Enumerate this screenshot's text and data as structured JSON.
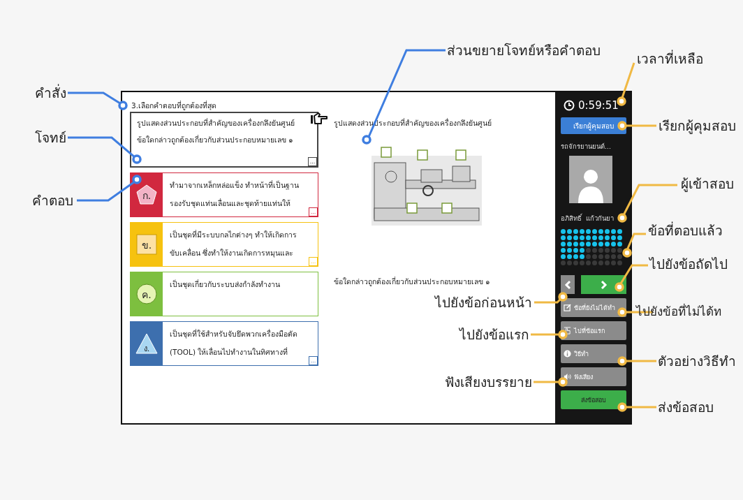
{
  "instruction": "3.เลือกคำตอบที่ถูกต้องที่สุด",
  "question": {
    "text": "รูปแสดงส่วนประกอบที่สำคัญของเครื่องกลึงยันศูนย์\nข้อใดกล่าวถูกต้องเกี่ยวกับส่วนประกอบหมายเลข ๑",
    "more": "..."
  },
  "choices": [
    {
      "label": "ก.",
      "kind": "pentagon",
      "color": "#d1283f",
      "text": "ทำมาจากเหล็กหล่อแข็ง ทำหน้าที่เป็นฐาน\nรองรับชุดแท่นเลื่อนและชุดท้ายแท่นให้",
      "more": "..."
    },
    {
      "label": "ข.",
      "kind": "square",
      "color": "#f6c20f",
      "text": "เป็นชุดที่มีระบบกลไกต่างๆ ทำให้เกิดการ\nขับเคลื่อน ซึ่งทำให้งานเกิดการหมุนและ",
      "more": "..."
    },
    {
      "label": "ค.",
      "kind": "circle",
      "color": "#7dbf3f",
      "text": "เป็นชุดเกี่ยวกับระบบส่งกำลังทำงาน"
    },
    {
      "label": "ง.",
      "kind": "triangle",
      "color": "#3d6fae",
      "text": "เป็นชุดที่ใช้สำหรับจับยึดพวกเครื่องมือตัด\n(TOOL) ให้เลื่อนไปทำงานในทิศทางที่",
      "more": "..."
    }
  ],
  "detail": {
    "caption": "รูปแสดงส่วนประกอบที่สำคัญของเครื่องกลึงยันศูนย์",
    "question": "ข้อใดกล่าวถูกต้องเกี่ยวกับส่วนประกอบหมายเลข ๑"
  },
  "sidebar": {
    "timer": "0:59:51",
    "call_button": "เรียกผู้คุมสอบ",
    "course": "รถจักรยานยนต์...",
    "examinee": [
      "อภิสิทธิ์",
      "แก้วกันยา"
    ],
    "answers": [
      [
        true,
        true,
        true,
        true,
        true,
        true,
        true,
        true,
        true,
        true
      ],
      [
        true,
        true,
        true,
        true,
        true,
        true,
        true,
        true,
        true,
        true
      ],
      [
        true,
        true,
        true,
        true,
        true,
        true,
        true,
        true,
        true,
        true
      ],
      [
        true,
        true,
        true,
        true,
        false,
        false,
        false,
        false,
        false,
        false
      ],
      [
        true,
        true,
        true,
        true,
        false,
        false,
        false,
        false,
        false,
        false
      ],
      [
        false,
        false,
        false,
        false,
        false,
        false,
        false,
        false,
        false,
        false
      ]
    ],
    "actions": [
      {
        "kind": "unanswered",
        "label": "ข้อที่ยังไม่ได้ทำ"
      },
      {
        "kind": "first",
        "label": "ไปที่ข้อแรก"
      },
      {
        "kind": "help",
        "label": "วิธีทำ"
      },
      {
        "kind": "audio",
        "label": "ฟังเสียง"
      },
      {
        "kind": "submit",
        "label": "ส่งข้อสอบ"
      }
    ]
  },
  "annotations": [
    {
      "text": "คำสั่ง",
      "color": "#3f7ee0"
    },
    {
      "text": "โจทย์",
      "color": "#3f7ee0"
    },
    {
      "text": "คำตอบ",
      "color": "#3f7ee0"
    },
    {
      "text": "ส่วนขยายโจทย์หรือคำตอบ",
      "color": "#3f7ee0"
    },
    {
      "text": "เวลาที่เหลือ",
      "color": "#f0b944"
    },
    {
      "text": "เรียกผู้คุมสอบ",
      "color": "#f0b944"
    },
    {
      "text": "ผู้เข้าสอบ",
      "color": "#f0b944"
    },
    {
      "text": "ข้อที่ตอบแล้ว",
      "color": "#f0b944"
    },
    {
      "text": "ไปยังข้อถัดไป",
      "color": "#f0b944"
    },
    {
      "text": "ไปยังข้อก่อนหน้า",
      "color": "#f0b944"
    },
    {
      "text": "ไปยังข้อที่ไม่ได้ท",
      "color": "#f0b944"
    },
    {
      "text": "ไปยังข้อแรก",
      "color": "#f0b944"
    },
    {
      "text": "ตัวอย่างวิธีทำ",
      "color": "#f0b944"
    },
    {
      "text": "ฟังเสียงบรรยาย",
      "color": "#f0b944"
    },
    {
      "text": "ส่งข้อสอบ",
      "color": "#f0b944"
    }
  ]
}
